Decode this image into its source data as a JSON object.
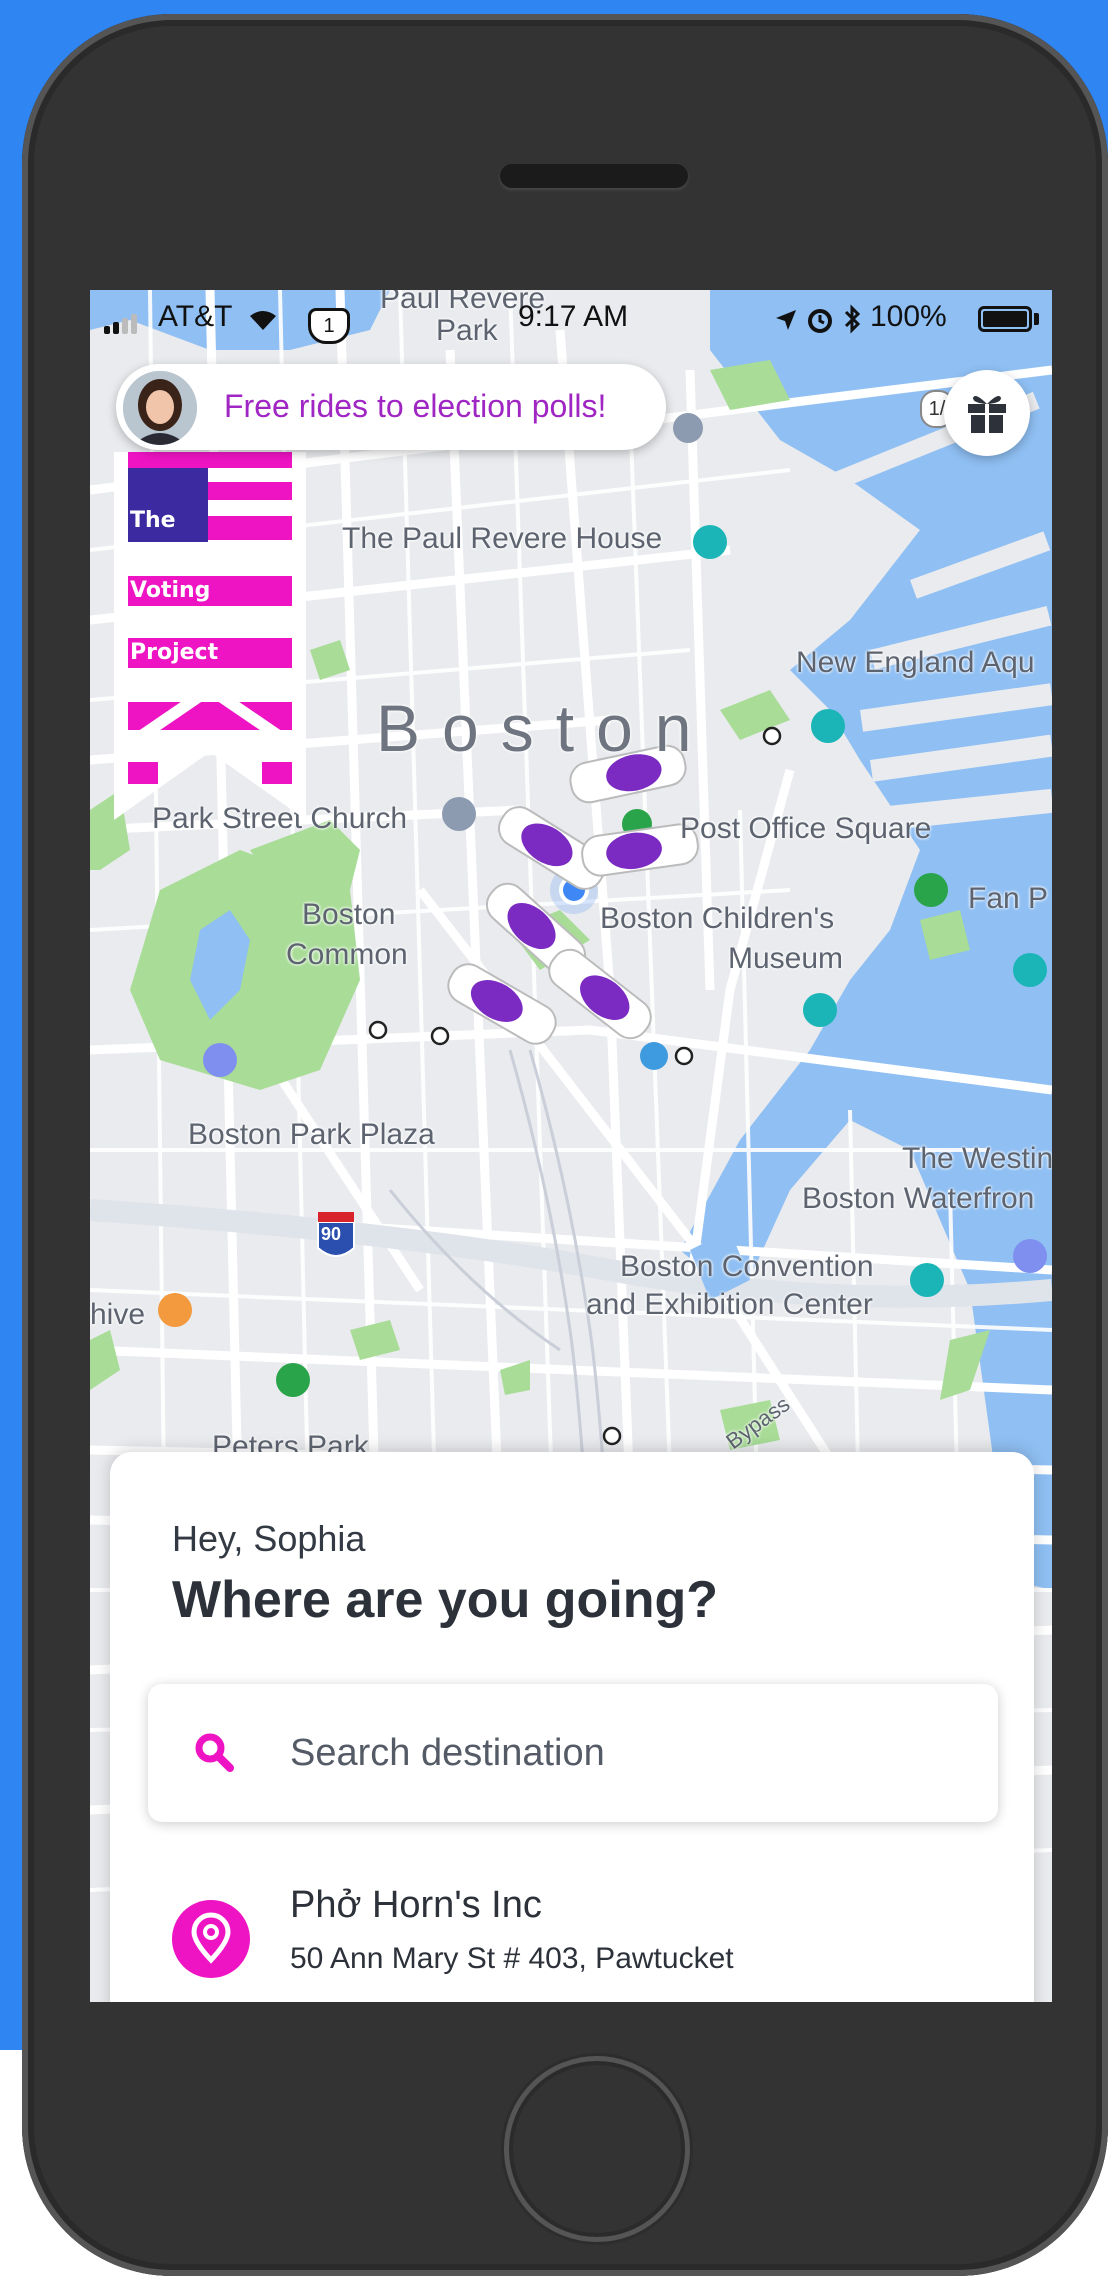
{
  "status_bar": {
    "carrier": "AT&T",
    "route_shield": "1",
    "time": "9:17 AM",
    "battery": "100%",
    "icons": [
      "signal-icon",
      "wifi-icon",
      "location-arrow-icon",
      "alarm-icon",
      "bluetooth-icon",
      "battery-icon"
    ]
  },
  "promo": {
    "text": "Free rides to election polls!"
  },
  "gift": {
    "badge": "1/"
  },
  "banner": {
    "lines": [
      "The",
      "Voting",
      "Project"
    ]
  },
  "map": {
    "city": "Boston",
    "labels": {
      "paul_revere_park": "Paul Revere",
      "park_word": "Park",
      "paul_revere_house": "The Paul Revere House",
      "new_england_aq": "New England Aqu",
      "park_street_church": "Park Street Church",
      "post_office_square": "Post Office Square",
      "boston_common_1": "Boston",
      "boston_common_2": "Common",
      "childrens_museum_1": "Boston Children's",
      "childrens_museum_2": "Museum",
      "fan_pier": "Fan P",
      "boston_park_plaza": "Boston Park Plaza",
      "westin_1": "The Westin",
      "westin_2": "Boston Waterfron",
      "convention_1": "Boston Convention",
      "convention_2": "and Exhibition Center",
      "hive": "hive",
      "peters_park": "Peters Park",
      "bypass": "Bypass",
      "interstate": "90"
    },
    "colors": {
      "water": "#8fbff3",
      "park": "#a8dc97",
      "road": "#ffffff",
      "land": "#e9ebee",
      "car": "#7b2bc2"
    }
  },
  "card": {
    "greeting": "Hey, Sophia",
    "question": "Where are you going?",
    "search_placeholder": "Search destination",
    "recent": {
      "name": "Phở Horn's Inc",
      "address": "50 Ann Mary St # 403, Pawtucket"
    }
  },
  "accent": "#ee14c3"
}
